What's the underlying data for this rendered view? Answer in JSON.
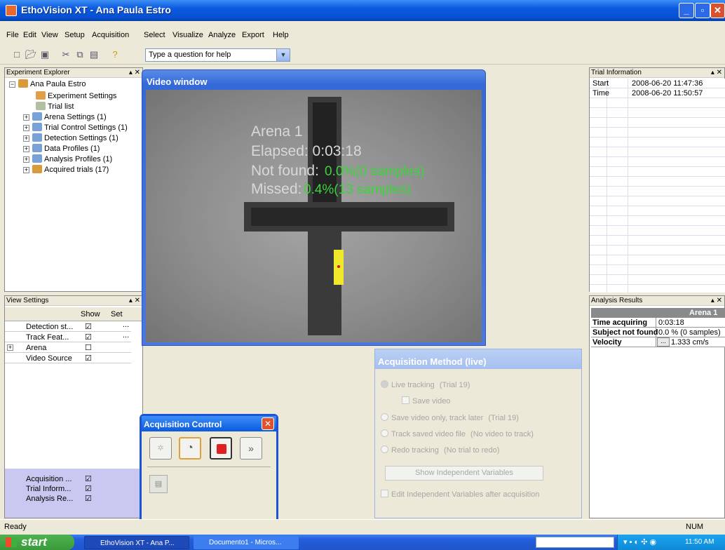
{
  "window": {
    "title": "EthoVision XT - Ana Paula Estro"
  },
  "menu": [
    "File",
    "Edit",
    "View",
    "Setup",
    "Acquisition",
    "Select",
    "Visualize",
    "Analyze",
    "Export",
    "Help"
  ],
  "toolbar": {
    "help_placeholder": "Type a question for help"
  },
  "explorer": {
    "title": "Experiment Explorer",
    "root": "Ana Paula Estro",
    "items": [
      "Experiment Settings",
      "Trial list",
      "Arena Settings (1)",
      "Trial Control Settings (1)",
      "Detection Settings (1)",
      "Data Profiles (1)",
      "Analysis Profiles (1)",
      "Acquired trials (17)"
    ]
  },
  "video": {
    "title": "Video window",
    "arena": "Arena 1",
    "elapsed": "Elapsed: 0:03:18",
    "notfound_label": "Not found:",
    "notfound_value": "0.0%(0 samples)",
    "missed_label": "Missed:",
    "missed_value": "0.4%(13 samples)"
  },
  "view_settings": {
    "title": "View Settings",
    "col_show": "Show",
    "col_set": "Set",
    "rows": [
      "Detection st...",
      "Track Feat...",
      "Arena",
      "Video Source"
    ],
    "bottom": [
      "Acquisition ...",
      "Trial Inform...",
      "Analysis Re..."
    ]
  },
  "acq_control": {
    "title": "Acquisition Control"
  },
  "acq_method": {
    "title": "Acquisition Method (live)",
    "live": "Live tracking",
    "live_trial": "(Trial  19)",
    "save_video": "Save video",
    "save_only": "Save video only, track later",
    "save_only_trial": "(Trial  19)",
    "track_saved": "Track saved video file",
    "track_saved_note": "(No video to track)",
    "redo": "Redo tracking",
    "redo_note": "(No trial to redo)",
    "show_iv": "Show Independent Variables",
    "edit_iv": "Edit Independent Variables after acquisition"
  },
  "trial_info": {
    "title": "Trial Information",
    "rows": [
      [
        "Start",
        "2008-06-20 11:47:36"
      ],
      [
        "Time",
        "2008-06-20 11:50:57"
      ]
    ]
  },
  "analysis": {
    "title": "Analysis Results",
    "col": "Arena 1",
    "rows": [
      [
        "Time acquiring",
        "0:03:18"
      ],
      [
        "Subject not found",
        "0.0 % (0 samples)"
      ],
      [
        "Velocity",
        "1.333 cm/s"
      ]
    ]
  },
  "status": {
    "left": "Ready",
    "right": "NUM"
  },
  "taskbar": {
    "start": "start",
    "tasks": [
      "EthoVision XT - Ana P...",
      "Documento1 - Micros..."
    ],
    "clock": "11:50 AM"
  }
}
